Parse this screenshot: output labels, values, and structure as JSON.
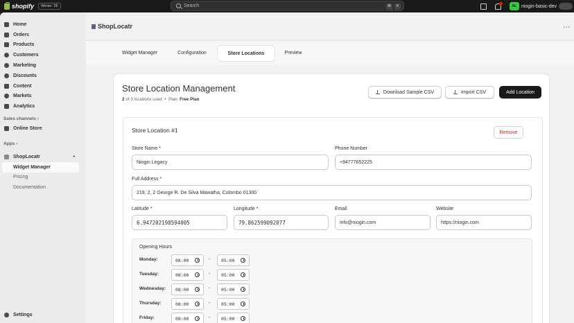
{
  "topbar": {
    "brand": "shopify",
    "edition": "Winter '26",
    "search_placeholder": "Search",
    "shortcut_keys": [
      "⌘",
      "K"
    ],
    "avatar_initials": "NL",
    "shop_name": "niogin-basic-dev"
  },
  "sidebar": {
    "items": [
      {
        "label": "Home",
        "icon": "home-icon"
      },
      {
        "label": "Orders",
        "icon": "orders-icon"
      },
      {
        "label": "Products",
        "icon": "tag-icon"
      },
      {
        "label": "Customers",
        "icon": "person-icon"
      },
      {
        "label": "Marketing",
        "icon": "target-icon"
      },
      {
        "label": "Discounts",
        "icon": "discount-icon"
      },
      {
        "label": "Content",
        "icon": "content-icon"
      },
      {
        "label": "Markets",
        "icon": "globe-icon"
      },
      {
        "label": "Analytics",
        "icon": "chart-icon"
      }
    ],
    "sales_channels_label": "Sales channels",
    "online_store": "Online Store",
    "apps_label": "Apps",
    "app_name": "ShopLocatr",
    "app_pin": "•",
    "sub_items": [
      "Widget Manager",
      "Pricing",
      "Documentation"
    ],
    "settings": "Settings"
  },
  "app": {
    "title": "ShopLocatr",
    "more": "⋯",
    "tabs": [
      "Widget Manager",
      "Configuration",
      "Store Locations",
      "Preview"
    ],
    "active_tab": "Store Locations"
  },
  "card": {
    "title": "Store Location Management",
    "usage_used": "2",
    "usage_rest": "of 3 locations used",
    "separator": "•",
    "plan_label": "Plan:",
    "plan_name": "Free Plan",
    "download_btn": "Download Sample CSV",
    "import_btn": "Import CSV",
    "add_btn": "Add Location"
  },
  "location": {
    "title": "Store Location #1",
    "remove": "Remove",
    "labels": {
      "name": "Store Name *",
      "phone": "Phone Number",
      "address": "Full Address *",
      "lat": "Latitude *",
      "lng": "Longitude *",
      "email": "Email",
      "website": "Website"
    },
    "values": {
      "name": "Niogin Legacy",
      "phone": "+94777652225",
      "address": "219, 2, 2 George R. De Silva Mawatha, Colombo 01300",
      "lat": "6.947202198594005",
      "lng": "79.862599092077",
      "email": "info@niogin.com",
      "website": "https://niogin.com"
    }
  },
  "hours": {
    "title": "Opening Hours",
    "days": [
      {
        "day": "Monday:",
        "open": "08:00",
        "close": "05:00"
      },
      {
        "day": "Tuesday:",
        "open": "08:00",
        "close": "05:00"
      },
      {
        "day": "Wednesday:",
        "open": "08:00",
        "close": "05:00"
      },
      {
        "day": "Thursday:",
        "open": "08:00",
        "close": "05:00"
      },
      {
        "day": "Friday:",
        "open": "08:00",
        "close": "05:00"
      }
    ],
    "separator": "-"
  }
}
